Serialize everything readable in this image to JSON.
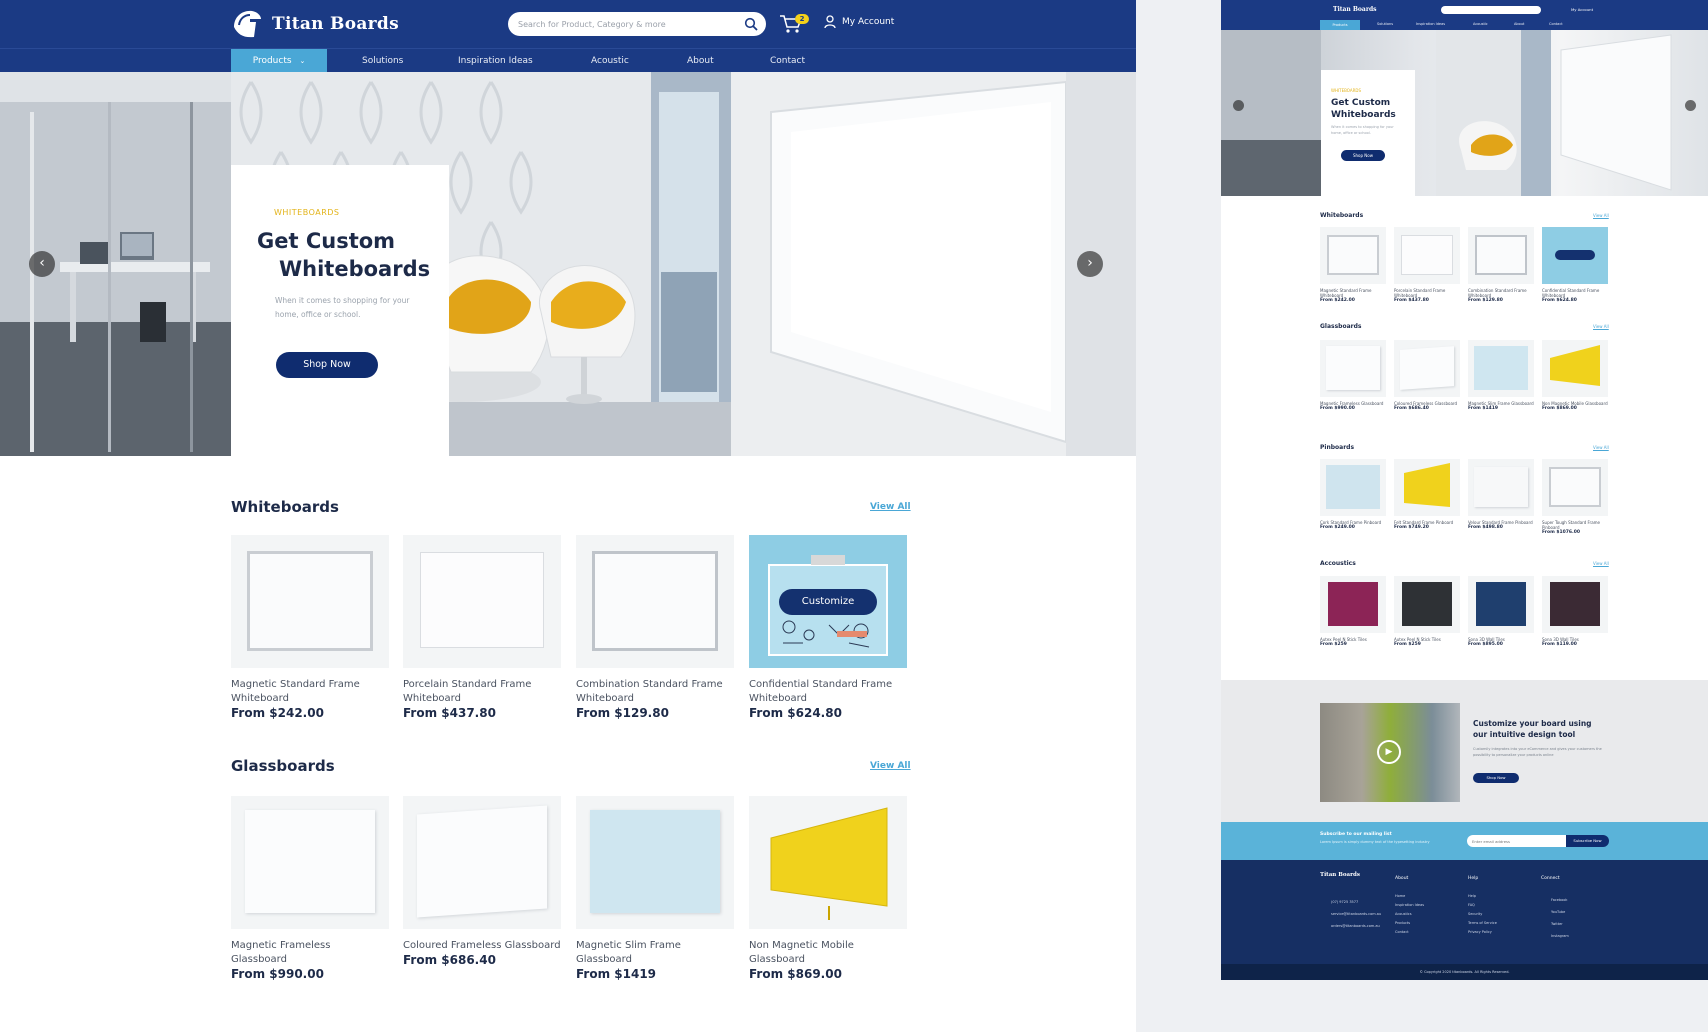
{
  "header": {
    "brand": "Titan Boards",
    "search_placeholder": "Search for Product, Category & more",
    "cart_count": "2",
    "account_label": "My Account"
  },
  "nav": {
    "items": [
      "Products",
      "Solutions",
      "Inspiration Ideas",
      "Acoustic",
      "About",
      "Contact"
    ]
  },
  "hero": {
    "kicker": "WHITEBOARDS",
    "title_line1": "Get Custom",
    "title_line2": "Whiteboards",
    "description": "When it comes to shopping for your home, office or school.",
    "button": "Shop Now"
  },
  "whiteboards": {
    "title": "Whiteboards",
    "view_all": "View All",
    "customize_label": "Customize",
    "products": [
      {
        "name": "Magnetic Standard Frame Whiteboard",
        "price": "From $242.00"
      },
      {
        "name": "Porcelain Standard Frame Whiteboard",
        "price": "From $437.80"
      },
      {
        "name": "Combination Standard Frame Whiteboard",
        "price": "From $129.80"
      },
      {
        "name": "Confidential Standard Frame Whiteboard",
        "price": "From $624.80"
      }
    ]
  },
  "glassboards": {
    "title": "Glassboards",
    "view_all": "View All",
    "products": [
      {
        "name": "Magnetic Frameless Glassboard",
        "price": "From $990.00"
      },
      {
        "name": "Coloured Frameless Glassboard",
        "price": "From $686.40"
      },
      {
        "name": "Magnetic Slim Frame Glassboard",
        "price": "From $1419"
      },
      {
        "name": "Non Magnetic Mobile Glassboard",
        "price": "From $869.00"
      }
    ]
  },
  "preview": {
    "header": {
      "brand": "Titan Boards",
      "account_label": "My Account"
    },
    "nav": [
      "Products",
      "Solutions",
      "Inspiration Ideas",
      "Acoustic",
      "About",
      "Contact"
    ],
    "hero": {
      "kicker": "WHITEBOARDS",
      "title_line1": "Get Custom",
      "title_line2": "Whiteboards",
      "description": "When it comes to shopping for your home, office or school.",
      "button": "Shop Now"
    },
    "sections": [
      {
        "title": "Whiteboards",
        "view_all": "View All",
        "products": [
          {
            "name": "Magnetic Standard Frame Whiteboard",
            "price": "From $242.00"
          },
          {
            "name": "Porcelain Standard Frame Whiteboard",
            "price": "From $437.80"
          },
          {
            "name": "Combination Standard Frame Whiteboard",
            "price": "From $129.80"
          },
          {
            "name": "Confidential Standard Frame Whiteboard",
            "price": "From $624.80"
          }
        ]
      },
      {
        "title": "Glassboards",
        "view_all": "View All",
        "products": [
          {
            "name": "Magnetic Frameless Glassboard",
            "price": "From $990.00"
          },
          {
            "name": "Coloured Frameless Glassboard",
            "price": "From $686.40"
          },
          {
            "name": "Magnetic Slim Frame Glassboard",
            "price": "From $1419"
          },
          {
            "name": "Non Magnetic Mobile Glassboard",
            "price": "From $869.00"
          }
        ]
      },
      {
        "title": "Pinboards",
        "view_all": "View All",
        "products": [
          {
            "name": "Cork Standard Frame Pinboard",
            "price": "From $249.00"
          },
          {
            "name": "Felt Standard Frame Pinboard",
            "price": "From $749.20"
          },
          {
            "name": "Velour Standard Frame Pinboard",
            "price": "From $498.80"
          },
          {
            "name": "Super Tough Standard Frame Pinboard",
            "price": "From $1076.00"
          }
        ]
      },
      {
        "title": "Accoustics",
        "view_all": "View All",
        "products": [
          {
            "name": "Autex Peel N Stick Tiles",
            "price": "From $259"
          },
          {
            "name": "Autex Peel N Stick Tiles",
            "price": "From $259"
          },
          {
            "name": "Sona 3D Wall Tiles",
            "price": "From $895.00"
          },
          {
            "name": "Sona 3D Wall Tiles",
            "price": "From $119.00"
          }
        ]
      }
    ],
    "promo": {
      "title": "Customize your board using our intuitive design tool",
      "description": "Customily integrates into your eCommerce and gives your customers the possibility to personalize your products online",
      "button": "Shop Now"
    },
    "mailing": {
      "title": "Subscribe to our mailing list",
      "subtitle": "Lorem Ipsum is simply dummy text of the typesetting industry",
      "placeholder": "Enter email address",
      "button": "Subscribe Now"
    },
    "footer": {
      "brand": "Titan Boards",
      "contacts": [
        "(07) 9725 3577",
        "service@titanboards.com.au",
        "orders@titanboards.com.au"
      ],
      "about_title": "About",
      "about_links": [
        "Home",
        "Inspiration Ideas",
        "Acoustics",
        "Products",
        "Contact"
      ],
      "help_title": "Help",
      "help_links": [
        "Help",
        "FAQ",
        "Security",
        "Terms of Service",
        "Privacy Policy"
      ],
      "connect_title": "Connect",
      "connect_links": [
        "Facebook",
        "YouTube",
        "Twitter",
        "Instagram"
      ],
      "copyright": "© Copyright 2020 titanboards. All Rights Reserved."
    }
  },
  "colors": {
    "brand_navy": "#1b3a84",
    "accent_blue": "#4aa7d6",
    "button_navy": "#0f2c6f",
    "kicker_gold": "#e3b41a",
    "glass_yellow": "#f0d21c"
  }
}
